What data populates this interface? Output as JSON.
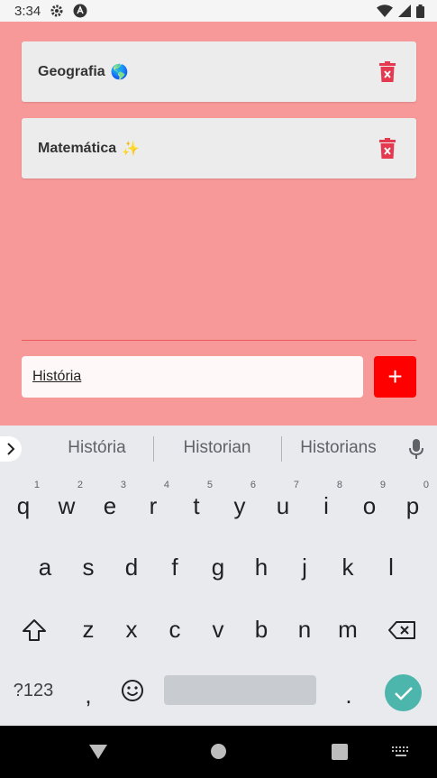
{
  "status_bar": {
    "time": "3:34",
    "icons": [
      "settings-icon",
      "app-notification-icon",
      "wifi-icon",
      "signal-icon",
      "battery-icon"
    ]
  },
  "items": [
    {
      "label": "Geografia",
      "emoji": "🌎"
    },
    {
      "label": "Matemática",
      "emoji": "✨"
    }
  ],
  "input": {
    "value": "História"
  },
  "add_button": {
    "label": "+"
  },
  "colors": {
    "background": "#f79999",
    "card": "#ececec",
    "trash": "#e53950",
    "add_button": "#ff0000",
    "enter_key": "#4db6ac"
  },
  "keyboard": {
    "suggestions": [
      "História",
      "Historian",
      "Historians"
    ],
    "row1": [
      {
        "k": "q",
        "h": "1"
      },
      {
        "k": "w",
        "h": "2"
      },
      {
        "k": "e",
        "h": "3"
      },
      {
        "k": "r",
        "h": "4"
      },
      {
        "k": "t",
        "h": "5"
      },
      {
        "k": "y",
        "h": "6"
      },
      {
        "k": "u",
        "h": "7"
      },
      {
        "k": "i",
        "h": "8"
      },
      {
        "k": "o",
        "h": "9"
      },
      {
        "k": "p",
        "h": "0"
      }
    ],
    "row2": [
      "a",
      "s",
      "d",
      "f",
      "g",
      "h",
      "j",
      "k",
      "l"
    ],
    "row3": [
      "z",
      "x",
      "c",
      "v",
      "b",
      "n",
      "m"
    ],
    "symbols_label": "?123",
    "comma": ",",
    "period": "."
  }
}
